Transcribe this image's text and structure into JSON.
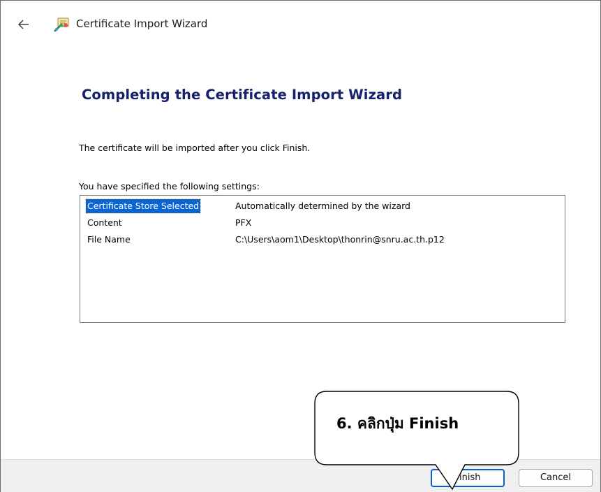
{
  "window": {
    "title": "Certificate Import Wizard",
    "back_icon": "back-arrow-icon",
    "app_icon": "certificate-wizard-icon"
  },
  "main": {
    "heading": "Completing the Certificate Import Wizard",
    "description": "The certificate will be imported after you click Finish.",
    "settings_label": "You have specified the following settings:",
    "settings": [
      {
        "name": "Certificate Store Selected",
        "value": "Automatically determined by the wizard",
        "selected": true
      },
      {
        "name": "Content",
        "value": "PFX",
        "selected": false
      },
      {
        "name": "File Name",
        "value": "C:\\Users\\aom1\\Desktop\\thonrin@snru.ac.th.p12",
        "selected": false
      }
    ]
  },
  "footer": {
    "finish_label": "Finish",
    "cancel_label": "Cancel"
  },
  "annotation": {
    "callout_text": "6. คลิกปุ่ม Finish"
  },
  "colors": {
    "heading": "#16206b",
    "selection": "#0a64d2",
    "footer_bg": "#f0f0f0",
    "default_button_border": "#0a5fc8"
  }
}
